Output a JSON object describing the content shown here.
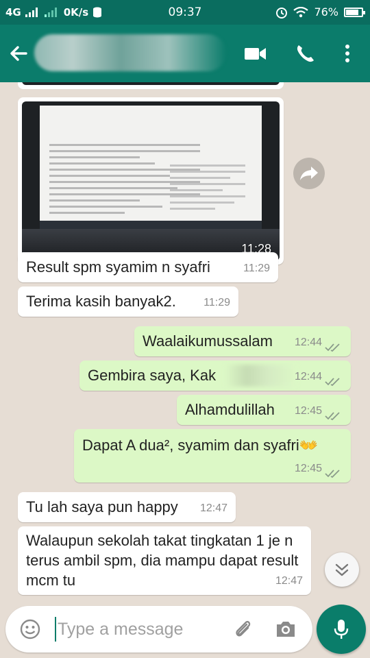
{
  "status_bar": {
    "network": "4G",
    "speed": "0K/s",
    "time": "09:37",
    "battery": "76%"
  },
  "header": {
    "contact_name": ""
  },
  "messages": [
    {
      "type": "image",
      "direction": "in",
      "time": "11:28"
    },
    {
      "type": "text",
      "direction": "in",
      "text": "Result spm syamim n syafri",
      "time": "11:29"
    },
    {
      "type": "text",
      "direction": "in",
      "text": "Terima kasih banyak2.",
      "time": "11:29"
    },
    {
      "type": "text",
      "direction": "out",
      "text": "Waalaikumussalam",
      "time": "12:44",
      "status": "read"
    },
    {
      "type": "text",
      "direction": "out",
      "text": "Gembira saya, Kak",
      "time": "12:44",
      "status": "read"
    },
    {
      "type": "text",
      "direction": "out",
      "text": "Alhamdulillah",
      "time": "12:45",
      "status": "read"
    },
    {
      "type": "text",
      "direction": "out",
      "text": "Dapat A dua², syamim dan syafri👐",
      "time": "12:45",
      "status": "read"
    },
    {
      "type": "text",
      "direction": "in",
      "text": "Tu lah saya pun happy",
      "time": "12:47"
    },
    {
      "type": "text",
      "direction": "in",
      "text": "Walaupun sekolah takat tingkatan 1 je n terus ambil spm, dia mampu dapat result mcm tu",
      "time": "12:47"
    }
  ],
  "input": {
    "placeholder": "Type a message"
  },
  "colors": {
    "header": "#0b7c6b",
    "outgoing_bubble": "#dcf8c6",
    "incoming_bubble": "#ffffff",
    "accent": "#0a7d6a"
  },
  "icons": [
    "back-arrow-icon",
    "video-call-icon",
    "phone-icon",
    "more-options-icon",
    "forward-icon",
    "scroll-down-icon",
    "emoji-icon",
    "attach-icon",
    "camera-icon",
    "mic-icon",
    "double-check-icon"
  ]
}
